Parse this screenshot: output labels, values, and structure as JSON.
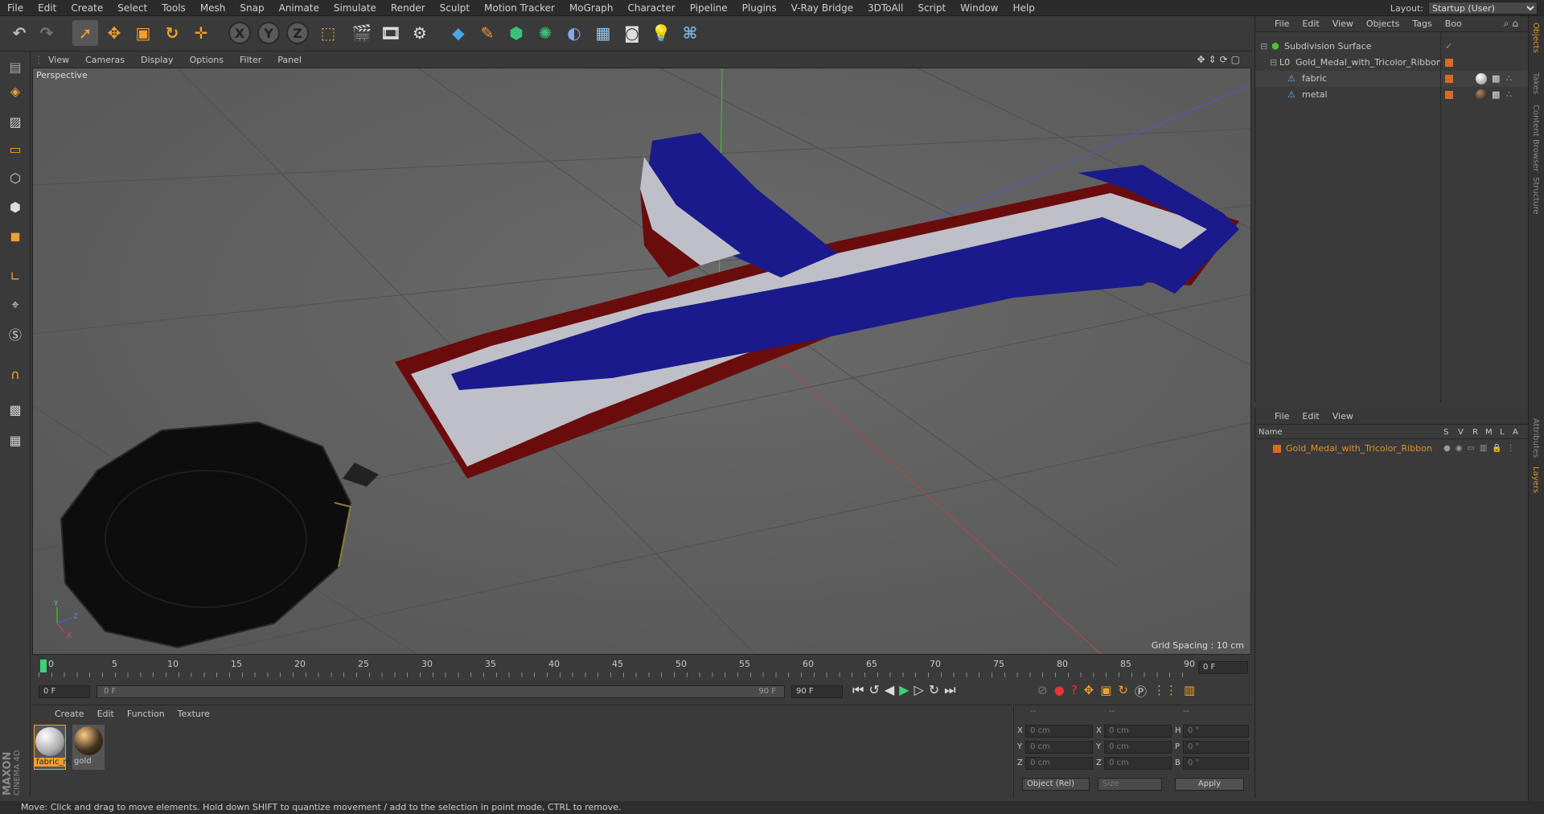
{
  "menubar": {
    "items": [
      "File",
      "Edit",
      "Create",
      "Select",
      "Tools",
      "Mesh",
      "Snap",
      "Animate",
      "Simulate",
      "Render",
      "Sculpt",
      "Motion Tracker",
      "MoGraph",
      "Character",
      "Pipeline",
      "Plugins",
      "V-Ray Bridge",
      "3DToAll",
      "Script",
      "Window",
      "Help"
    ],
    "layout_label": "Layout:",
    "layout_value": "Startup (User)"
  },
  "viewport": {
    "menu": [
      "View",
      "Cameras",
      "Display",
      "Options",
      "Filter",
      "Panel"
    ],
    "label": "Perspective",
    "grid_spacing": "Grid Spacing : 10 cm"
  },
  "timeline": {
    "ticks": [
      "0",
      "5",
      "10",
      "15",
      "20",
      "25",
      "30",
      "35",
      "40",
      "45",
      "50",
      "55",
      "60",
      "65",
      "70",
      "75",
      "80",
      "85",
      "90"
    ],
    "current_frame": "0 F",
    "start_field": "0 F",
    "range_start": "0 F",
    "range_end": "90 F",
    "end_field": "90 F"
  },
  "materials": {
    "menu": [
      "Create",
      "Edit",
      "Function",
      "Texture"
    ],
    "items": [
      {
        "name": "fabric_m",
        "kind": "white"
      },
      {
        "name": "gold",
        "kind": "dark"
      }
    ]
  },
  "attributes": {
    "headers": [
      "--",
      "--",
      "--"
    ],
    "rows": [
      {
        "a": "X",
        "av": "0 cm",
        "b": "X",
        "bv": "0 cm",
        "c": "H",
        "cv": "0 °"
      },
      {
        "a": "Y",
        "av": "0 cm",
        "b": "Y",
        "bv": "0 cm",
        "c": "P",
        "cv": "0 °"
      },
      {
        "a": "Z",
        "av": "0 cm",
        "b": "Z",
        "bv": "0 cm",
        "c": "B",
        "cv": "0 °"
      }
    ],
    "coord_mode": "Object (Rel)",
    "size_mode": "Size",
    "apply": "Apply"
  },
  "object_manager": {
    "menu": [
      "File",
      "Edit",
      "View",
      "Objects",
      "Tags",
      "Boo"
    ],
    "objects": [
      {
        "name": "Subdivision Surface",
        "color": "#4fc23c",
        "indent": 0
      },
      {
        "name": "Gold_Medal_with_Tricolor_Ribbon",
        "color": "#d76b25",
        "indent": 1
      },
      {
        "name": "fabric",
        "color": "#d76b25",
        "indent": 2
      },
      {
        "name": "metal",
        "color": "#d76b25",
        "indent": 2
      }
    ]
  },
  "layer_manager": {
    "menu": [
      "File",
      "Edit",
      "View"
    ],
    "columns": [
      "Name",
      "S",
      "V",
      "R",
      "M",
      "L",
      "A"
    ],
    "layers": [
      {
        "name": "Gold_Medal_with_Tricolor_Ribbon",
        "color": "#e0902a"
      }
    ]
  },
  "right_tabs": [
    "Objects",
    "Takes",
    "Content Browser",
    "Structure",
    "Attributes",
    "Layers"
  ],
  "logo": {
    "brand": "MAXON",
    "product": "CINEMA 4D"
  },
  "status": "Move: Click and drag to move elements. Hold down SHIFT to quantize movement / add to the selection in point mode, CTRL to remove."
}
